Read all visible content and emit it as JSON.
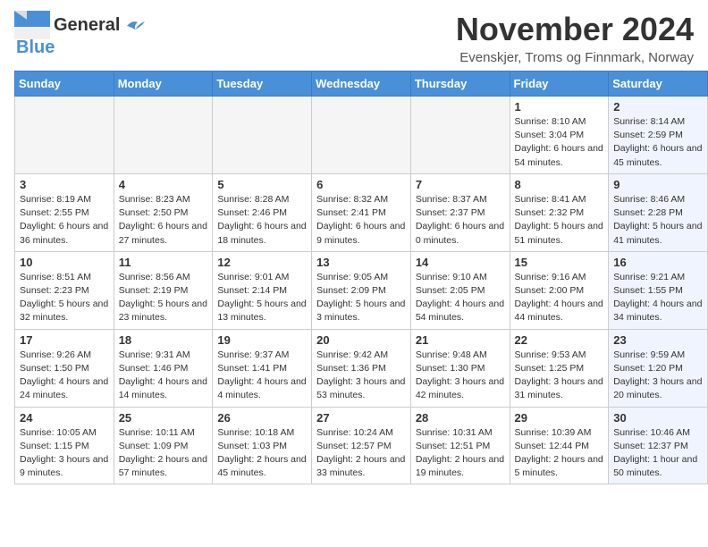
{
  "header": {
    "logo_general": "General",
    "logo_blue": "Blue",
    "month_title": "November 2024",
    "location": "Evenskjer, Troms og Finnmark, Norway"
  },
  "weekdays": [
    "Sunday",
    "Monday",
    "Tuesday",
    "Wednesday",
    "Thursday",
    "Friday",
    "Saturday"
  ],
  "weeks": [
    [
      {
        "day": "",
        "info": ""
      },
      {
        "day": "",
        "info": ""
      },
      {
        "day": "",
        "info": ""
      },
      {
        "day": "",
        "info": ""
      },
      {
        "day": "",
        "info": ""
      },
      {
        "day": "1",
        "info": "Sunrise: 8:10 AM\nSunset: 3:04 PM\nDaylight: 6 hours and 54 minutes."
      },
      {
        "day": "2",
        "info": "Sunrise: 8:14 AM\nSunset: 2:59 PM\nDaylight: 6 hours and 45 minutes."
      }
    ],
    [
      {
        "day": "3",
        "info": "Sunrise: 8:19 AM\nSunset: 2:55 PM\nDaylight: 6 hours and 36 minutes."
      },
      {
        "day": "4",
        "info": "Sunrise: 8:23 AM\nSunset: 2:50 PM\nDaylight: 6 hours and 27 minutes."
      },
      {
        "day": "5",
        "info": "Sunrise: 8:28 AM\nSunset: 2:46 PM\nDaylight: 6 hours and 18 minutes."
      },
      {
        "day": "6",
        "info": "Sunrise: 8:32 AM\nSunset: 2:41 PM\nDaylight: 6 hours and 9 minutes."
      },
      {
        "day": "7",
        "info": "Sunrise: 8:37 AM\nSunset: 2:37 PM\nDaylight: 6 hours and 0 minutes."
      },
      {
        "day": "8",
        "info": "Sunrise: 8:41 AM\nSunset: 2:32 PM\nDaylight: 5 hours and 51 minutes."
      },
      {
        "day": "9",
        "info": "Sunrise: 8:46 AM\nSunset: 2:28 PM\nDaylight: 5 hours and 41 minutes."
      }
    ],
    [
      {
        "day": "10",
        "info": "Sunrise: 8:51 AM\nSunset: 2:23 PM\nDaylight: 5 hours and 32 minutes."
      },
      {
        "day": "11",
        "info": "Sunrise: 8:56 AM\nSunset: 2:19 PM\nDaylight: 5 hours and 23 minutes."
      },
      {
        "day": "12",
        "info": "Sunrise: 9:01 AM\nSunset: 2:14 PM\nDaylight: 5 hours and 13 minutes."
      },
      {
        "day": "13",
        "info": "Sunrise: 9:05 AM\nSunset: 2:09 PM\nDaylight: 5 hours and 3 minutes."
      },
      {
        "day": "14",
        "info": "Sunrise: 9:10 AM\nSunset: 2:05 PM\nDaylight: 4 hours and 54 minutes."
      },
      {
        "day": "15",
        "info": "Sunrise: 9:16 AM\nSunset: 2:00 PM\nDaylight: 4 hours and 44 minutes."
      },
      {
        "day": "16",
        "info": "Sunrise: 9:21 AM\nSunset: 1:55 PM\nDaylight: 4 hours and 34 minutes."
      }
    ],
    [
      {
        "day": "17",
        "info": "Sunrise: 9:26 AM\nSunset: 1:50 PM\nDaylight: 4 hours and 24 minutes."
      },
      {
        "day": "18",
        "info": "Sunrise: 9:31 AM\nSunset: 1:46 PM\nDaylight: 4 hours and 14 minutes."
      },
      {
        "day": "19",
        "info": "Sunrise: 9:37 AM\nSunset: 1:41 PM\nDaylight: 4 hours and 4 minutes."
      },
      {
        "day": "20",
        "info": "Sunrise: 9:42 AM\nSunset: 1:36 PM\nDaylight: 3 hours and 53 minutes."
      },
      {
        "day": "21",
        "info": "Sunrise: 9:48 AM\nSunset: 1:30 PM\nDaylight: 3 hours and 42 minutes."
      },
      {
        "day": "22",
        "info": "Sunrise: 9:53 AM\nSunset: 1:25 PM\nDaylight: 3 hours and 31 minutes."
      },
      {
        "day": "23",
        "info": "Sunrise: 9:59 AM\nSunset: 1:20 PM\nDaylight: 3 hours and 20 minutes."
      }
    ],
    [
      {
        "day": "24",
        "info": "Sunrise: 10:05 AM\nSunset: 1:15 PM\nDaylight: 3 hours and 9 minutes."
      },
      {
        "day": "25",
        "info": "Sunrise: 10:11 AM\nSunset: 1:09 PM\nDaylight: 2 hours and 57 minutes."
      },
      {
        "day": "26",
        "info": "Sunrise: 10:18 AM\nSunset: 1:03 PM\nDaylight: 2 hours and 45 minutes."
      },
      {
        "day": "27",
        "info": "Sunrise: 10:24 AM\nSunset: 12:57 PM\nDaylight: 2 hours and 33 minutes."
      },
      {
        "day": "28",
        "info": "Sunrise: 10:31 AM\nSunset: 12:51 PM\nDaylight: 2 hours and 19 minutes."
      },
      {
        "day": "29",
        "info": "Sunrise: 10:39 AM\nSunset: 12:44 PM\nDaylight: 2 hours and 5 minutes."
      },
      {
        "day": "30",
        "info": "Sunrise: 10:46 AM\nSunset: 12:37 PM\nDaylight: 1 hour and 50 minutes."
      }
    ]
  ]
}
